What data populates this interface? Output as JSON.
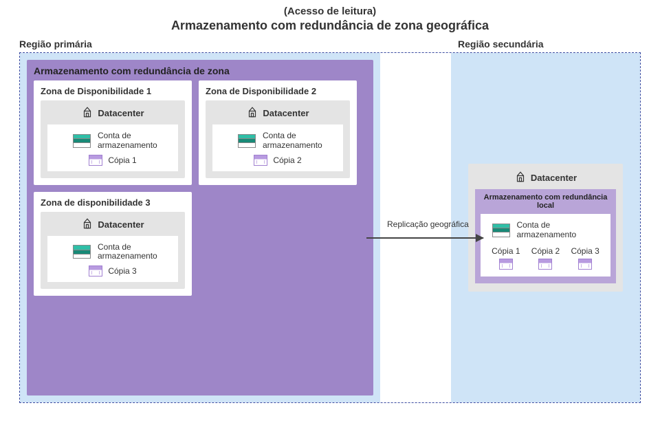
{
  "title": {
    "sub": "(Acesso de leitura)",
    "main": "Armazenamento com redundância de zona geográfica"
  },
  "regions": {
    "primary_label": "Região primária",
    "secondary_label": "Região secundária"
  },
  "primary": {
    "feature_title": "Armazenamento com redundância de zona",
    "zones": {
      "z1": {
        "title": "Zona de Disponibilidade 1",
        "datacenter": "Datacenter",
        "storage": "Conta de armazenamento",
        "copy": "Cópia 1"
      },
      "z2": {
        "title": "Zona de Disponibilidade 2",
        "datacenter": "Datacenter",
        "storage": "Conta de armazenamento",
        "copy": "Cópia 2"
      },
      "z3": {
        "title": "Zona de disponibilidade 3",
        "datacenter": "Datacenter",
        "storage": "Conta de armazenamento",
        "copy": "Cópia 3"
      }
    }
  },
  "replication_label": "Replicação geográfica",
  "secondary": {
    "datacenter": "Datacenter",
    "lrs_title": "Armazenamento com redundância local",
    "storage": "Conta de armazenamento",
    "copies": {
      "c1": "Cópia 1",
      "c2": "Cópia 2",
      "c3": "Cópia 3"
    }
  }
}
